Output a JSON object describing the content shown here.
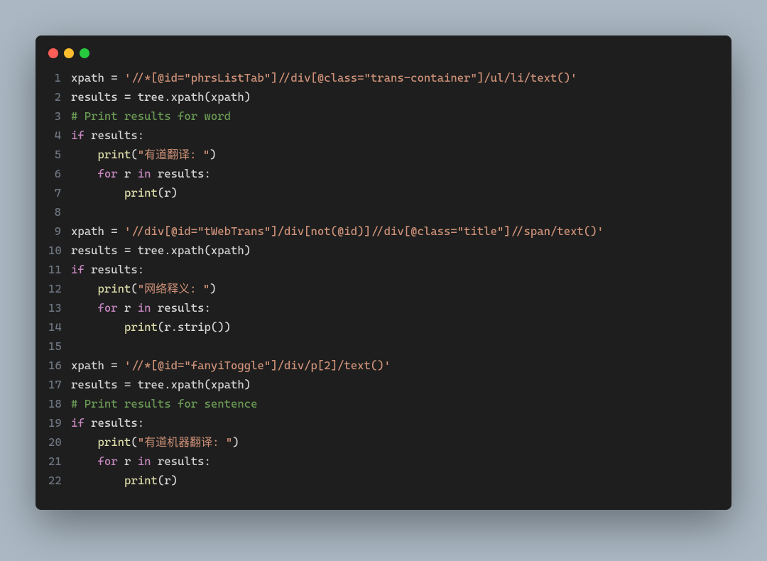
{
  "window": {
    "dots": [
      "red",
      "yellow",
      "green"
    ]
  },
  "code": {
    "lines": [
      {
        "num": "1",
        "tokens": [
          {
            "cls": "tok-var",
            "text": "xpath "
          },
          {
            "cls": "tok-op",
            "text": "= "
          },
          {
            "cls": "tok-str",
            "text": "'//*[@id=\"phrsListTab\"]//div[@class=\"trans-container\"]/ul/li/text()'"
          }
        ]
      },
      {
        "num": "2",
        "tokens": [
          {
            "cls": "tok-var",
            "text": "results "
          },
          {
            "cls": "tok-op",
            "text": "= "
          },
          {
            "cls": "tok-var",
            "text": "tree.xpath(xpath)"
          }
        ]
      },
      {
        "num": "3",
        "tokens": [
          {
            "cls": "tok-com",
            "text": "# Print results for word"
          }
        ]
      },
      {
        "num": "4",
        "tokens": [
          {
            "cls": "tok-kw",
            "text": "if"
          },
          {
            "cls": "tok-var",
            "text": " results:"
          }
        ]
      },
      {
        "num": "5",
        "tokens": [
          {
            "cls": "tok-var",
            "text": "    "
          },
          {
            "cls": "tok-fn",
            "text": "print"
          },
          {
            "cls": "tok-pun",
            "text": "("
          },
          {
            "cls": "tok-str",
            "text": "\"有道翻译: \""
          },
          {
            "cls": "tok-pun",
            "text": ")"
          }
        ]
      },
      {
        "num": "6",
        "tokens": [
          {
            "cls": "tok-var",
            "text": "    "
          },
          {
            "cls": "tok-kw",
            "text": "for"
          },
          {
            "cls": "tok-var",
            "text": " r "
          },
          {
            "cls": "tok-kw",
            "text": "in"
          },
          {
            "cls": "tok-var",
            "text": " results:"
          }
        ]
      },
      {
        "num": "7",
        "tokens": [
          {
            "cls": "tok-var",
            "text": "        "
          },
          {
            "cls": "tok-fn",
            "text": "print"
          },
          {
            "cls": "tok-pun",
            "text": "(r)"
          }
        ]
      },
      {
        "num": "8",
        "tokens": []
      },
      {
        "num": "9",
        "tokens": [
          {
            "cls": "tok-var",
            "text": "xpath "
          },
          {
            "cls": "tok-op",
            "text": "= "
          },
          {
            "cls": "tok-str",
            "text": "'//div[@id=\"tWebTrans\"]/div[not(@id)]//div[@class=\"title\"]//span/text()'"
          }
        ]
      },
      {
        "num": "10",
        "tokens": [
          {
            "cls": "tok-var",
            "text": "results "
          },
          {
            "cls": "tok-op",
            "text": "= "
          },
          {
            "cls": "tok-var",
            "text": "tree.xpath(xpath)"
          }
        ]
      },
      {
        "num": "11",
        "tokens": [
          {
            "cls": "tok-kw",
            "text": "if"
          },
          {
            "cls": "tok-var",
            "text": " results:"
          }
        ]
      },
      {
        "num": "12",
        "tokens": [
          {
            "cls": "tok-var",
            "text": "    "
          },
          {
            "cls": "tok-fn",
            "text": "print"
          },
          {
            "cls": "tok-pun",
            "text": "("
          },
          {
            "cls": "tok-str",
            "text": "\"网络释义: \""
          },
          {
            "cls": "tok-pun",
            "text": ")"
          }
        ]
      },
      {
        "num": "13",
        "tokens": [
          {
            "cls": "tok-var",
            "text": "    "
          },
          {
            "cls": "tok-kw",
            "text": "for"
          },
          {
            "cls": "tok-var",
            "text": " r "
          },
          {
            "cls": "tok-kw",
            "text": "in"
          },
          {
            "cls": "tok-var",
            "text": " results:"
          }
        ]
      },
      {
        "num": "14",
        "tokens": [
          {
            "cls": "tok-var",
            "text": "        "
          },
          {
            "cls": "tok-fn",
            "text": "print"
          },
          {
            "cls": "tok-pun",
            "text": "(r.strip())"
          }
        ]
      },
      {
        "num": "15",
        "tokens": []
      },
      {
        "num": "16",
        "tokens": [
          {
            "cls": "tok-var",
            "text": "xpath "
          },
          {
            "cls": "tok-op",
            "text": "= "
          },
          {
            "cls": "tok-str",
            "text": "'//*[@id=\"fanyiToggle\"]/div/p[2]/text()'"
          }
        ]
      },
      {
        "num": "17",
        "tokens": [
          {
            "cls": "tok-var",
            "text": "results "
          },
          {
            "cls": "tok-op",
            "text": "= "
          },
          {
            "cls": "tok-var",
            "text": "tree.xpath(xpath)"
          }
        ]
      },
      {
        "num": "18",
        "tokens": [
          {
            "cls": "tok-com",
            "text": "# Print results for sentence"
          }
        ]
      },
      {
        "num": "19",
        "tokens": [
          {
            "cls": "tok-kw",
            "text": "if"
          },
          {
            "cls": "tok-var",
            "text": " results:"
          }
        ]
      },
      {
        "num": "20",
        "tokens": [
          {
            "cls": "tok-var",
            "text": "    "
          },
          {
            "cls": "tok-fn",
            "text": "print"
          },
          {
            "cls": "tok-pun",
            "text": "("
          },
          {
            "cls": "tok-str",
            "text": "\"有道机器翻译: \""
          },
          {
            "cls": "tok-pun",
            "text": ")"
          }
        ]
      },
      {
        "num": "21",
        "tokens": [
          {
            "cls": "tok-var",
            "text": "    "
          },
          {
            "cls": "tok-kw",
            "text": "for"
          },
          {
            "cls": "tok-var",
            "text": " r "
          },
          {
            "cls": "tok-kw",
            "text": "in"
          },
          {
            "cls": "tok-var",
            "text": " results:"
          }
        ]
      },
      {
        "num": "22",
        "tokens": [
          {
            "cls": "tok-var",
            "text": "        "
          },
          {
            "cls": "tok-fn",
            "text": "print"
          },
          {
            "cls": "tok-pun",
            "text": "(r)"
          }
        ]
      }
    ]
  }
}
